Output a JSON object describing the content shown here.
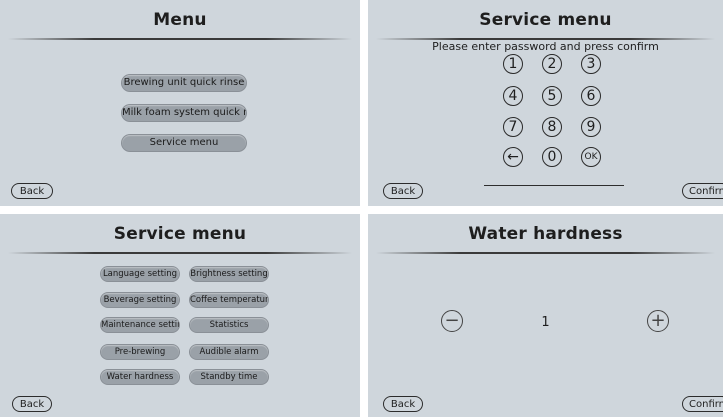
{
  "menu": {
    "title": "Menu",
    "items": [
      "Brewing unit quick rinse",
      "Milk foam system quick rinse",
      "Service menu"
    ],
    "back_label": "Back"
  },
  "service_password": {
    "title": "Service menu",
    "prompt": "Please enter password and press confirm",
    "keys": [
      "1",
      "2",
      "3",
      "4",
      "5",
      "6",
      "7",
      "8",
      "9",
      "←",
      "0",
      "OK"
    ],
    "back_label": "Back",
    "confirm_label": "Confirm"
  },
  "service_menu": {
    "title": "Service menu",
    "left_items": [
      "Language setting",
      "Beverage setting",
      "Maintenance settings",
      "Pre-brewing",
      "Water hardness"
    ],
    "right_items": [
      "Brightness setting",
      "Coffee temperature",
      "Statistics",
      "Audible alarm",
      "Standby time"
    ],
    "back_label": "Back"
  },
  "water_hardness": {
    "title": "Water hardness",
    "value": "1",
    "minus_icon": "−",
    "plus_icon": "+",
    "back_label": "Back",
    "confirm_label": "Confirm"
  },
  "colors": {
    "panel_bg": "#cfd6dc",
    "pill_bg": "#9aa1a8"
  }
}
